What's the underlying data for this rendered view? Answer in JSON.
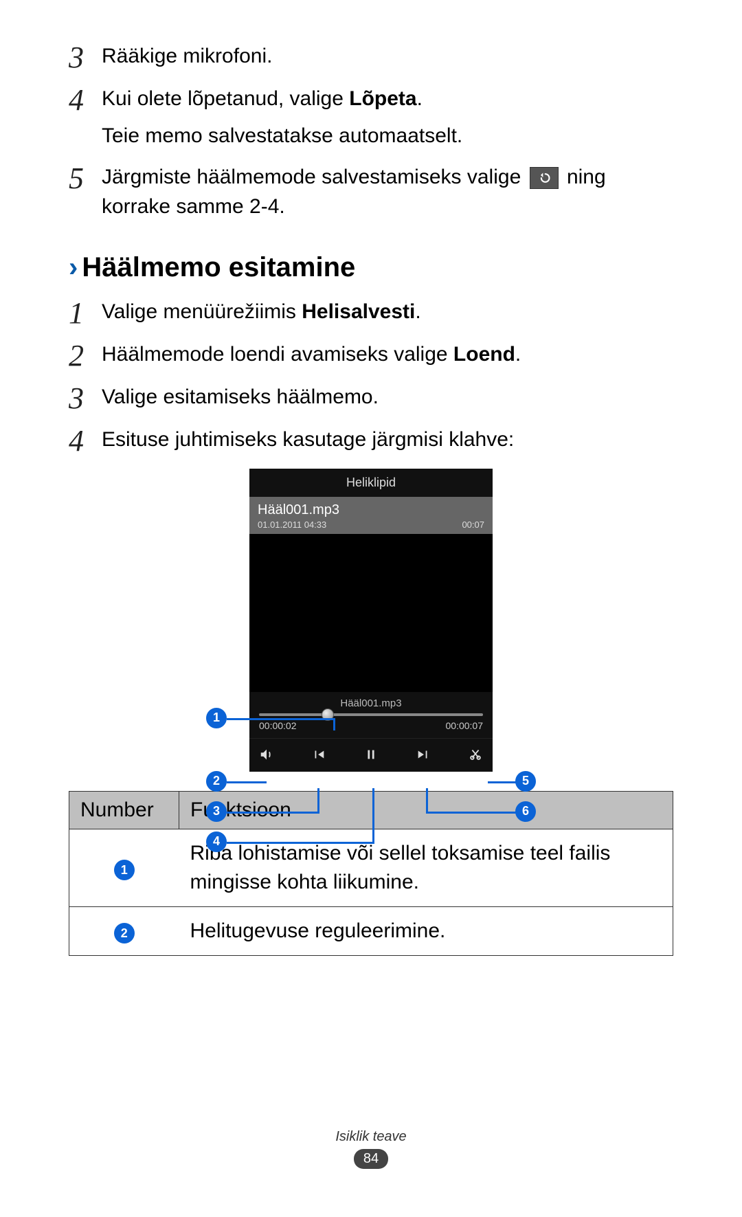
{
  "steps_top": [
    {
      "num": "3",
      "text": "Rääkige mikrofoni."
    },
    {
      "num": "4",
      "text_before": "Kui olete lõpetanud, valige ",
      "bold": "Lõpeta",
      "text_after": ".",
      "sub": "Teie memo salvestatakse automaatselt."
    },
    {
      "num": "5",
      "text_before": "Järgmiste häälmemode salvestamiseks valige ",
      "icon": "back-icon",
      "text_after": " ning korrake samme 2-4."
    }
  ],
  "section_heading": "Häälmemo esitamine",
  "steps_bottom": [
    {
      "num": "1",
      "text_before": "Valige menüürežiimis ",
      "bold": "Helisalvesti",
      "text_after": "."
    },
    {
      "num": "2",
      "text_before": "Häälmemode loendi avamiseks valige ",
      "bold": "Loend",
      "text_after": "."
    },
    {
      "num": "3",
      "text": "Valige esitamiseks häälmemo."
    },
    {
      "num": "4",
      "text": "Esituse juhtimiseks kasutage järgmisi klahve:"
    }
  ],
  "phone": {
    "header": "Heliklipid",
    "file": "Hääl001.mp3",
    "date": "01.01.2011 04:33",
    "dur": "00:07",
    "nowplaying": "Hääl001.mp3",
    "elapsed": "00:00:02",
    "total": "00:00:07"
  },
  "callout_labels": {
    "c1": "1",
    "c2": "2",
    "c3": "3",
    "c4": "4",
    "c5": "5",
    "c6": "6"
  },
  "table": {
    "h1": "Number",
    "h2": "Funktsioon",
    "rows": [
      {
        "n": "1",
        "f": "Riba lohistamise või sellel toksamise teel failis mingisse kohta liikumine."
      },
      {
        "n": "2",
        "f": "Helitugevuse reguleerimine."
      }
    ]
  },
  "footer": {
    "section": "Isiklik teave",
    "page": "84"
  }
}
